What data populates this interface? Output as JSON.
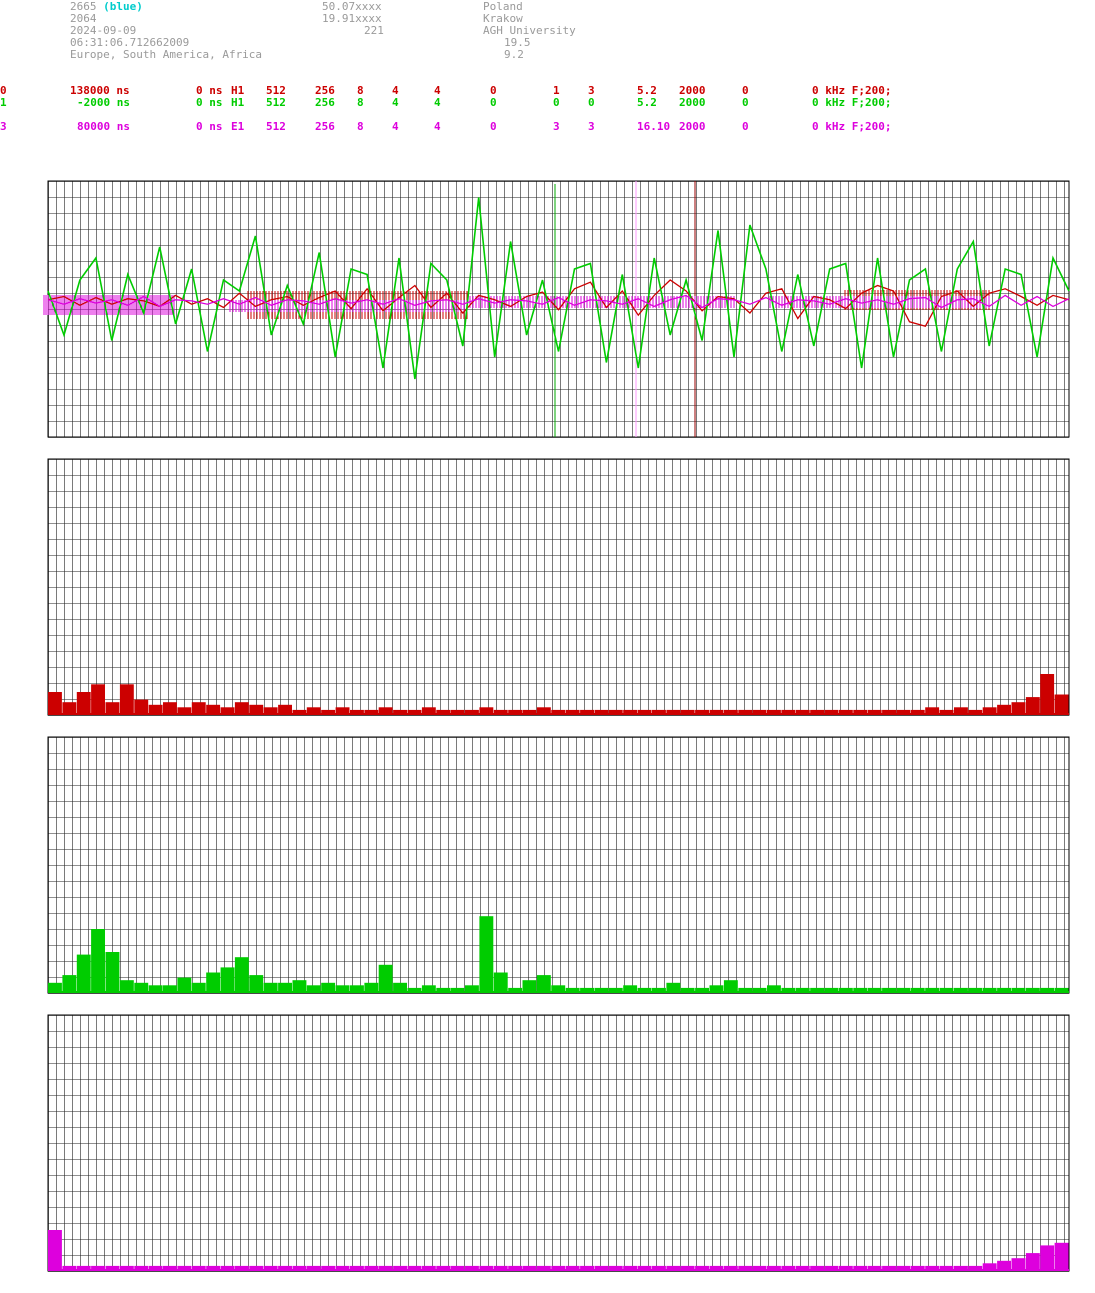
{
  "header": {
    "col1": [
      "2665",
      "2064",
      "2024-09-09",
      "06:31:06.712662009",
      "Europe, South America, Africa"
    ],
    "col1_suffix": "(blue)",
    "col2": [
      "50.07xxxx",
      "19.91xxxx",
      "221"
    ],
    "col3": [
      "Poland",
      "Krakow",
      "AGH University",
      "19.5",
      "9.2"
    ]
  },
  "rows": [
    {
      "id": "0",
      "color": "#cc0000",
      "delay": "138000 ns",
      "offset": "0 ns",
      "ch": "H1",
      "n1": "512",
      "n2": "256",
      "n3": "8",
      "n4": "4",
      "n5": "4",
      "n6": "0",
      "n7": "1",
      "n8": "3",
      "freq": "5.2",
      "rate": "2000",
      "n9": "0",
      "tail": "0 kHz F;200;"
    },
    {
      "id": "1",
      "color": "#00cc00",
      "delay": "-2000 ns",
      "offset": "0 ns",
      "ch": "H1",
      "n1": "512",
      "n2": "256",
      "n3": "8",
      "n4": "4",
      "n5": "4",
      "n6": "0",
      "n7": "0",
      "n8": "0",
      "freq": "5.2",
      "rate": "2000",
      "n9": "0",
      "tail": "0 kHz F;200;"
    },
    {
      "id": "3",
      "color": "#dd00dd",
      "delay": "80000 ns",
      "offset": "0 ns",
      "ch": "E1",
      "n1": "512",
      "n2": "256",
      "n3": "8",
      "n4": "4",
      "n5": "4",
      "n6": "0",
      "n7": "3",
      "n8": "3",
      "freq": "16.10",
      "rate": "2000",
      "n9": "0",
      "tail": "0 kHz F;200;"
    }
  ],
  "colors": {
    "red": "#cc0000",
    "green": "#00cc00",
    "magenta": "#dd00dd",
    "grid": "#000000"
  },
  "chart_data": [
    {
      "type": "line",
      "grid": true,
      "series": [
        {
          "color": "#cc0000",
          "values": [
            0.02,
            0.05,
            -0.03,
            0.04,
            -0.02,
            0.03,
            0.01,
            -0.04,
            0.06,
            -0.02,
            0.03,
            -0.05,
            0.08,
            -0.04,
            0.02,
            0.05,
            -0.03,
            0.04,
            0.1,
            -0.06,
            0.12,
            -0.08,
            0.04,
            0.15,
            -0.05,
            0.08,
            -0.1,
            0.06,
            0.02,
            -0.04,
            0.05,
            0.09,
            -0.07,
            0.12,
            0.18,
            -0.05,
            0.1,
            -0.12,
            0.06,
            0.2,
            0.1,
            -0.08,
            0.05,
            0.03,
            -0.1,
            0.08,
            0.12,
            -0.15,
            0.05,
            0.02,
            -0.06,
            0.08,
            0.15,
            0.1,
            -0.18,
            -0.22,
            0.05,
            0.1,
            -0.04,
            0.08,
            0.12,
            0.05,
            -0.03,
            0.06,
            0.02
          ]
        },
        {
          "color": "#00cc00",
          "values": [
            0.1,
            -0.3,
            0.2,
            0.4,
            -0.35,
            0.25,
            -0.1,
            0.5,
            -0.2,
            0.3,
            -0.45,
            0.2,
            0.1,
            0.6,
            -0.3,
            0.15,
            -0.2,
            0.45,
            -0.5,
            0.3,
            0.25,
            -0.6,
            0.4,
            -0.7,
            0.35,
            0.2,
            -0.4,
            0.95,
            -0.5,
            0.55,
            -0.3,
            0.2,
            -0.45,
            0.3,
            0.35,
            -0.55,
            0.25,
            -0.6,
            0.4,
            -0.3,
            0.2,
            -0.35,
            0.65,
            -0.5,
            0.7,
            0.3,
            -0.45,
            0.25,
            -0.4,
            0.3,
            0.35,
            -0.6,
            0.4,
            -0.5,
            0.2,
            0.3,
            -0.45,
            0.3,
            0.55,
            -0.4,
            0.3,
            0.25,
            -0.5,
            0.4,
            0.1
          ]
        },
        {
          "color": "#dd00dd",
          "values": [
            0.02,
            -0.02,
            0.03,
            -0.01,
            0.02,
            -0.03,
            0.05,
            -0.04,
            0.02,
            0.01,
            -0.02,
            0.03,
            -0.02,
            0.04,
            -0.03,
            0.02,
            0.01,
            -0.02,
            0.03,
            -0.01,
            0.02,
            -0.02,
            0.03,
            -0.03,
            0.01,
            0.02,
            -0.02,
            0.03,
            -0.01,
            0.02,
            0.01,
            -0.02,
            0.04,
            -0.03,
            0.02,
            0.01,
            -0.02,
            0.03,
            -0.04,
            0.02,
            0.06,
            -0.05,
            0.03,
            0.02,
            -0.02,
            0.04,
            -0.03,
            0.02,
            0.01,
            -0.02,
            0.03,
            -0.01,
            0.02,
            -0.02,
            0.03,
            0.04,
            -0.05,
            0.02,
            0.03,
            -0.04,
            0.06,
            -0.03,
            0.05,
            -0.04,
            0.03
          ]
        }
      ]
    },
    {
      "type": "bar",
      "color": "#cc0000",
      "values": [
        0.09,
        0.05,
        0.09,
        0.12,
        0.05,
        0.12,
        0.06,
        0.04,
        0.05,
        0.03,
        0.05,
        0.04,
        0.03,
        0.05,
        0.04,
        0.03,
        0.04,
        0.02,
        0.03,
        0.02,
        0.03,
        0.02,
        0.02,
        0.03,
        0.02,
        0.02,
        0.03,
        0.02,
        0.02,
        0.02,
        0.03,
        0.02,
        0.02,
        0.02,
        0.03,
        0.02,
        0.02,
        0.02,
        0.02,
        0.02,
        0.02,
        0.02,
        0.02,
        0.02,
        0.02,
        0.02,
        0.02,
        0.02,
        0.02,
        0.02,
        0.02,
        0.02,
        0.02,
        0.02,
        0.02,
        0.02,
        0.02,
        0.02,
        0.02,
        0.02,
        0.02,
        0.03,
        0.02,
        0.03,
        0.02,
        0.03,
        0.04,
        0.05,
        0.07,
        0.16,
        0.08
      ]
    },
    {
      "type": "bar",
      "color": "#00cc00",
      "values": [
        0.04,
        0.07,
        0.15,
        0.25,
        0.16,
        0.05,
        0.04,
        0.03,
        0.03,
        0.06,
        0.04,
        0.08,
        0.1,
        0.14,
        0.07,
        0.04,
        0.04,
        0.05,
        0.03,
        0.04,
        0.03,
        0.03,
        0.04,
        0.11,
        0.04,
        0.02,
        0.03,
        0.02,
        0.02,
        0.03,
        0.3,
        0.08,
        0.02,
        0.05,
        0.07,
        0.03,
        0.02,
        0.02,
        0.02,
        0.02,
        0.03,
        0.02,
        0.02,
        0.04,
        0.02,
        0.02,
        0.03,
        0.05,
        0.02,
        0.02,
        0.03,
        0.02,
        0.02,
        0.02,
        0.02,
        0.02,
        0.02,
        0.02,
        0.02,
        0.02,
        0.02,
        0.02,
        0.02,
        0.02,
        0.02,
        0.02,
        0.02,
        0.02,
        0.02,
        0.02,
        0.02
      ]
    },
    {
      "type": "bar",
      "color": "#dd00dd",
      "values": [
        0.16,
        0.02,
        0.02,
        0.02,
        0.02,
        0.02,
        0.02,
        0.02,
        0.02,
        0.02,
        0.02,
        0.02,
        0.02,
        0.02,
        0.02,
        0.02,
        0.02,
        0.02,
        0.02,
        0.02,
        0.02,
        0.02,
        0.02,
        0.02,
        0.02,
        0.02,
        0.02,
        0.02,
        0.02,
        0.02,
        0.02,
        0.02,
        0.02,
        0.02,
        0.02,
        0.02,
        0.02,
        0.02,
        0.02,
        0.02,
        0.02,
        0.02,
        0.02,
        0.02,
        0.02,
        0.02,
        0.02,
        0.02,
        0.02,
        0.02,
        0.02,
        0.02,
        0.02,
        0.02,
        0.02,
        0.02,
        0.02,
        0.02,
        0.02,
        0.02,
        0.02,
        0.02,
        0.02,
        0.02,
        0.02,
        0.03,
        0.04,
        0.05,
        0.07,
        0.1,
        0.11
      ]
    }
  ]
}
